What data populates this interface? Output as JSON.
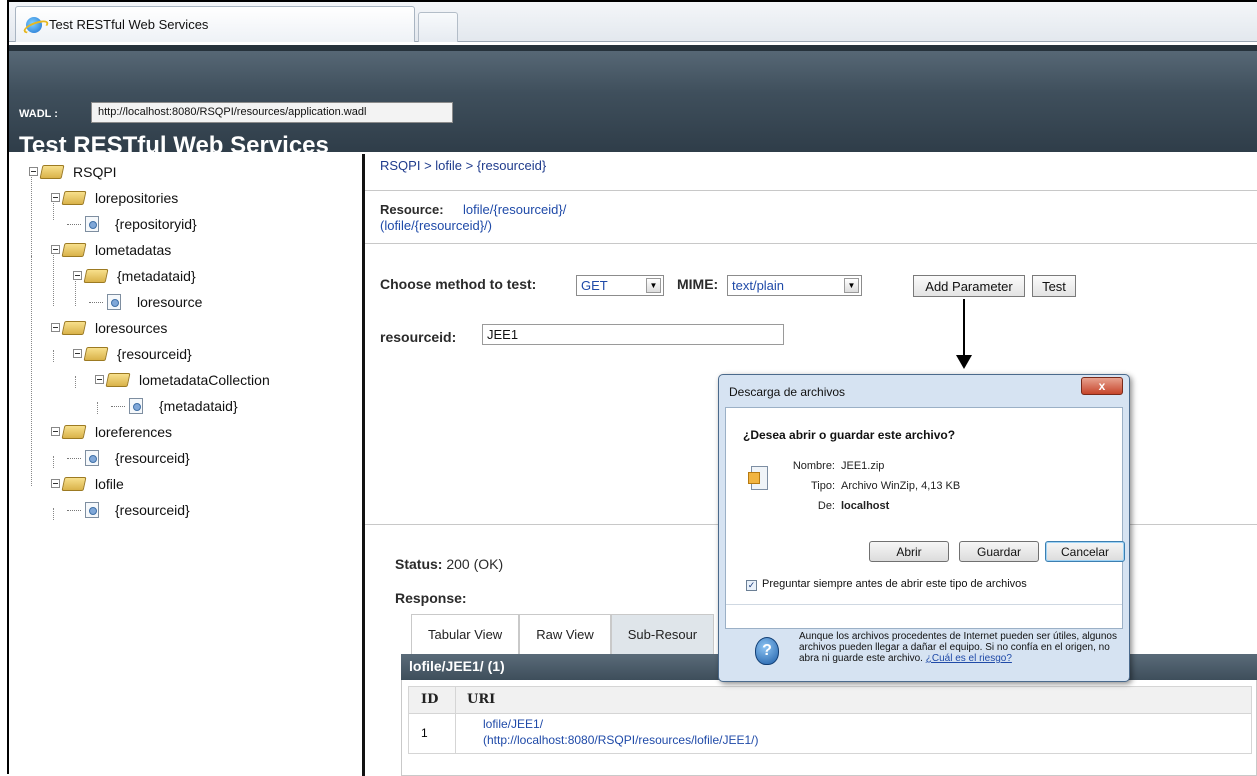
{
  "browser": {
    "tab_title": "Test RESTful Web Services"
  },
  "header": {
    "wadl_label": "WADL :",
    "wadl_url": "http://localhost:8080/RSQPI/resources/application.wadl",
    "title": "Test RESTful Web Services"
  },
  "tree": {
    "root": "RSQPI",
    "items": [
      {
        "label": "lorepositories"
      },
      {
        "label": "{repositoryid}"
      },
      {
        "label": "lometadatas"
      },
      {
        "label": "{metadataid}"
      },
      {
        "label": "loresource"
      },
      {
        "label": "loresources"
      },
      {
        "label": "{resourceid}"
      },
      {
        "label": "lometadataCollection"
      },
      {
        "label": "{metadataid}"
      },
      {
        "label": "loreferences"
      },
      {
        "label": "{resourceid}"
      },
      {
        "label": "lofile"
      },
      {
        "label": "{resourceid}"
      }
    ]
  },
  "main": {
    "breadcrumb": "RSQPI > lofile > {resourceid}",
    "resource_label": "Resource:",
    "resource_link": "lofile/{resourceid}/",
    "resource_sub": "(lofile/{resourceid}/)",
    "method_label": "Choose method to test:",
    "method_value": "GET",
    "mime_label": "MIME:",
    "mime_value": "text/plain",
    "add_parameter": "Add Parameter",
    "test": "Test",
    "resourceid_label": "resourceid:",
    "resourceid_value": "JEE1",
    "status_label": "Status:",
    "status_value": "200 (OK)",
    "response_label": "Response:",
    "tabs": [
      {
        "label": "Tabular View"
      },
      {
        "label": "Raw View"
      },
      {
        "label": "Sub-Resour"
      }
    ],
    "result_header": "lofile/JEE1/ (1)",
    "table": {
      "col_id": "ID",
      "col_uri": "URI",
      "row_id": "1",
      "row_uri": "lofile/JEE1/",
      "row_uri_full": "(http://localhost:8080/RSQPI/resources/lofile/JEE1/)"
    }
  },
  "dialog": {
    "title": "Descarga de archivos",
    "close": "x",
    "question": "¿Desea abrir o guardar este archivo?",
    "name_key": "Nombre:",
    "name_value": "JEE1.zip",
    "type_key": "Tipo:",
    "type_value": "Archivo WinZip, 4,13 KB",
    "from_key": "De:",
    "from_value": "localhost",
    "open": "Abrir",
    "save": "Guardar",
    "cancel": "Cancelar",
    "checkbox_label": "Preguntar siempre antes de abrir este tipo de archivos",
    "warning": "Aunque los archivos procedentes de Internet pueden ser útiles, algunos archivos pueden llegar a dañar el equipo. Si no confía en el origen, no abra ni guarde este archivo.",
    "risk_link": "¿Cuál es el riesgo?"
  },
  "colors": {
    "header_bg": "#3f4f5c",
    "link": "#1f4aa8",
    "dialog_bg": "#d6e3f2"
  }
}
